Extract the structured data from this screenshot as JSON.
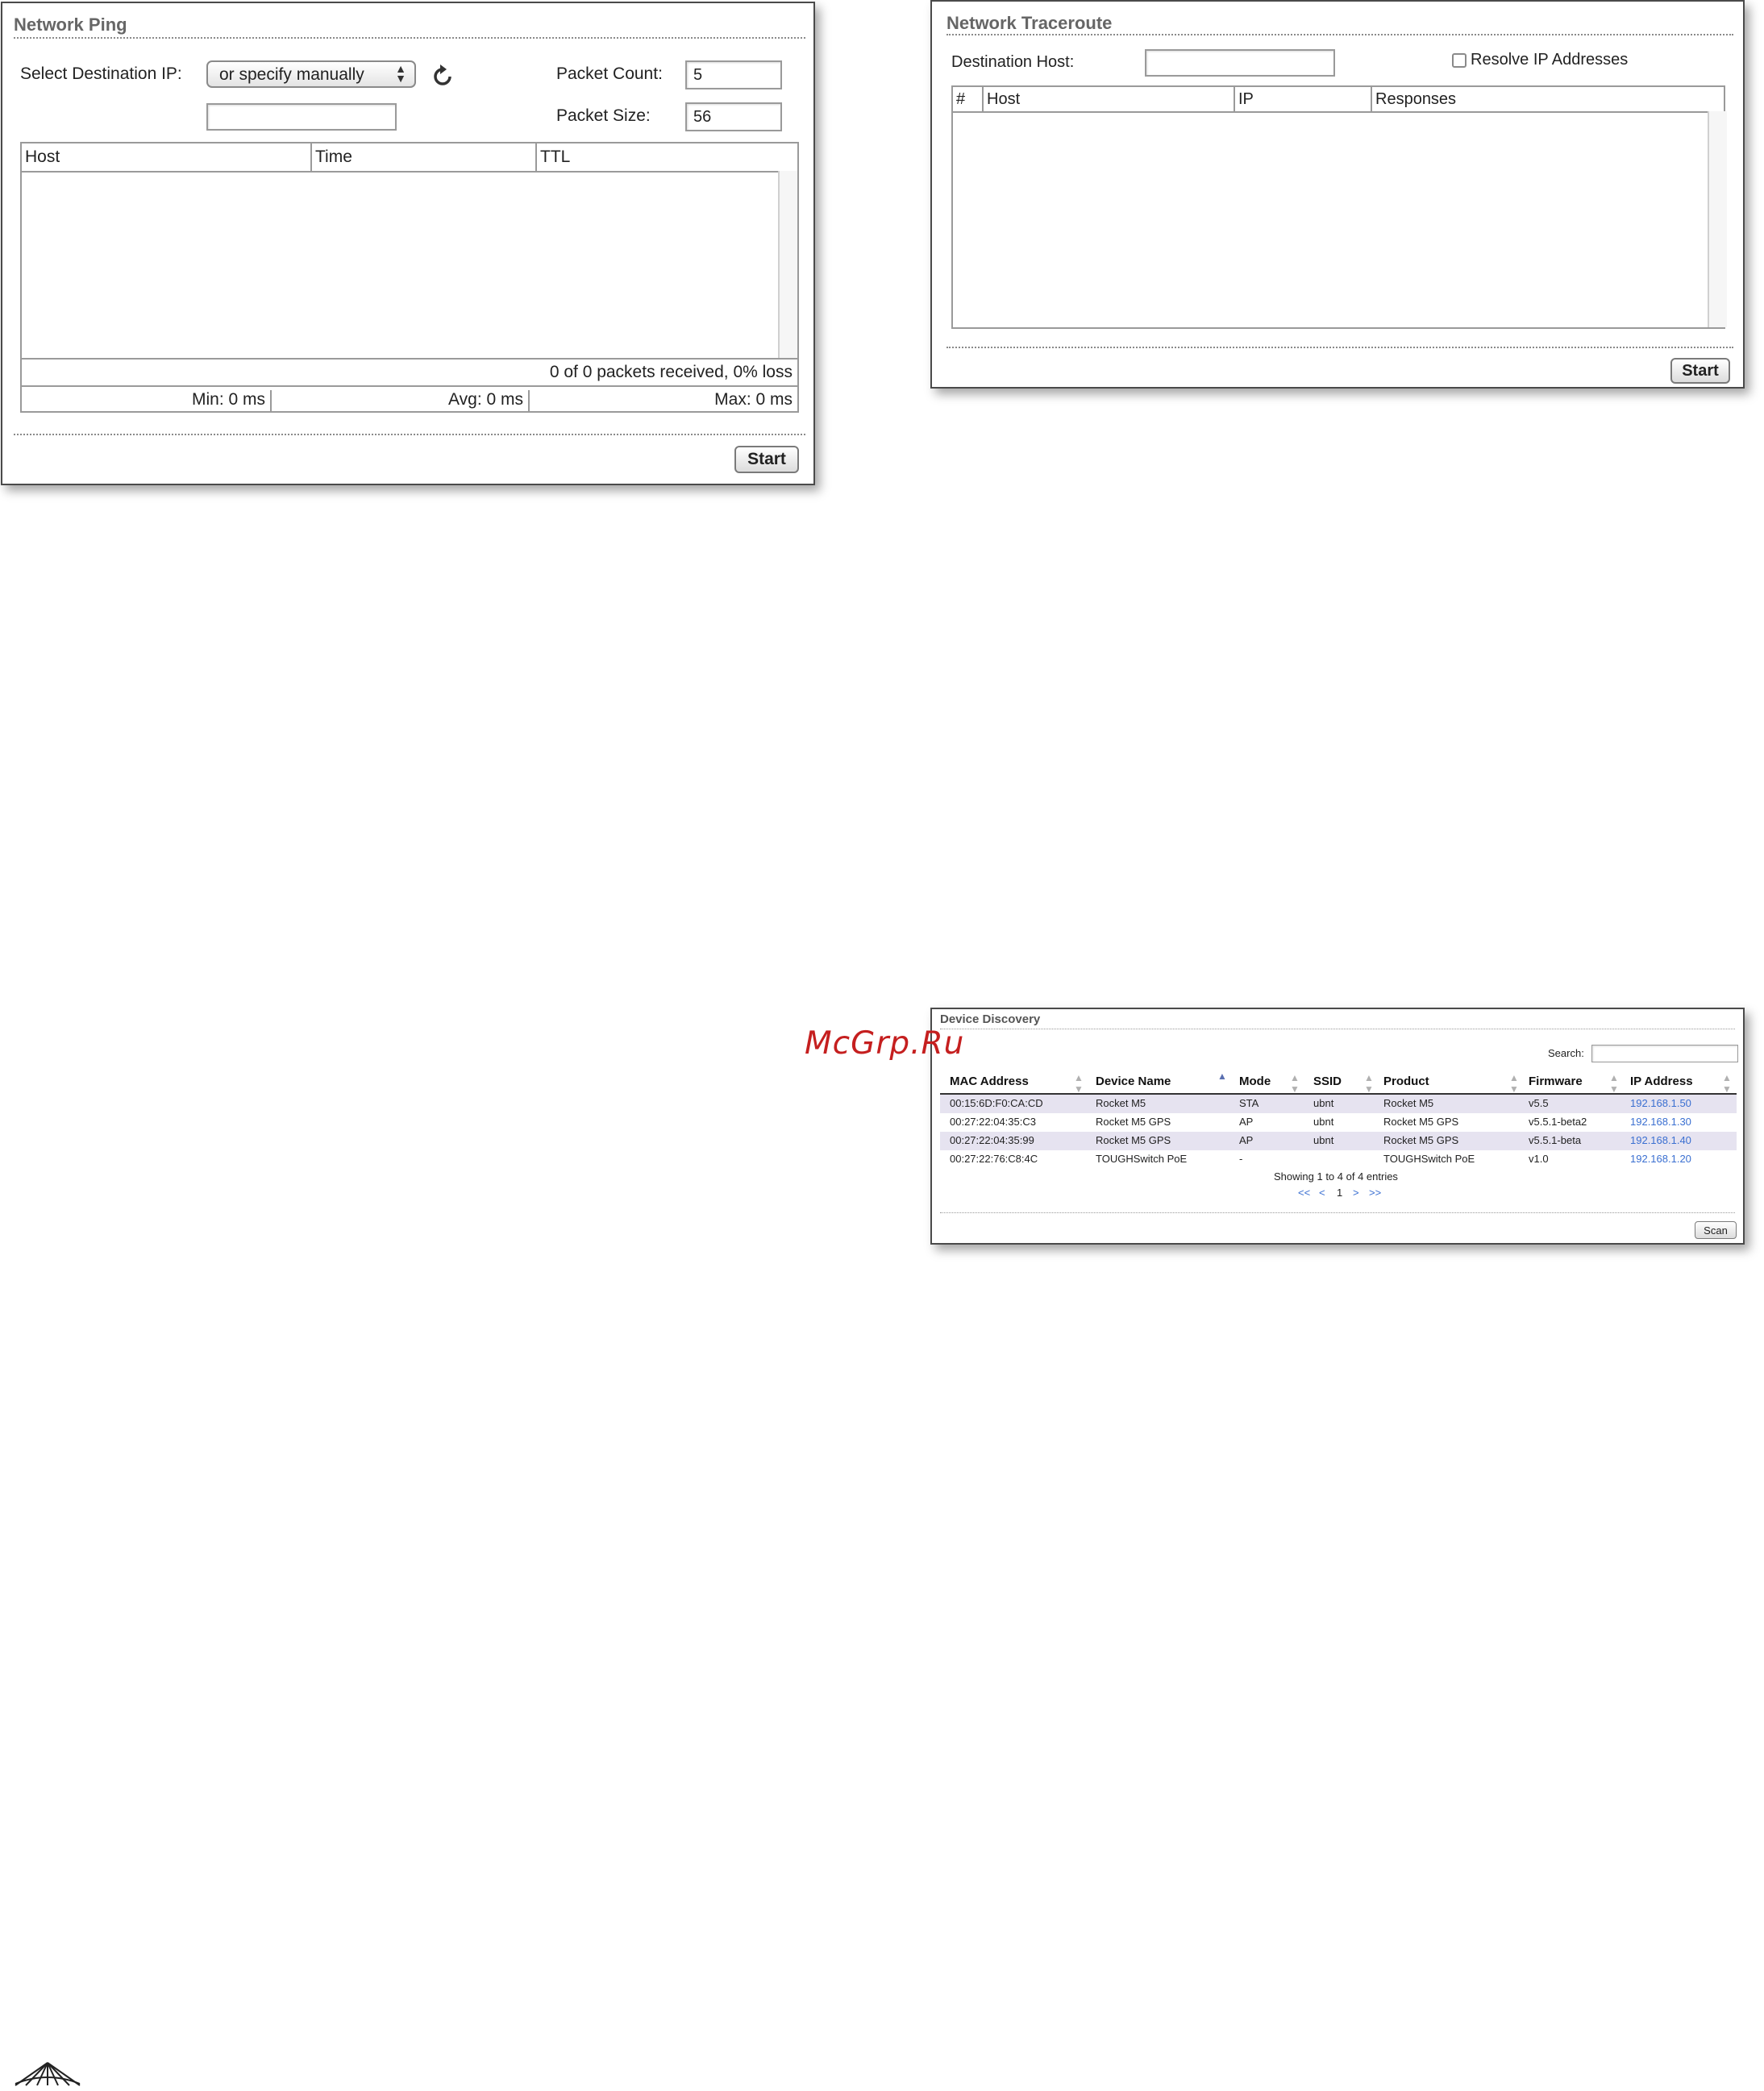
{
  "ping": {
    "title": "Network Ping",
    "dest_label": "Select Destination IP:",
    "dest_select": "or specify manually",
    "manual_ip_value": "",
    "count_label": "Packet Count:",
    "count_value": "5",
    "size_label": "Packet Size:",
    "size_value": "56",
    "columns": [
      "Host",
      "Time",
      "TTL"
    ],
    "summary": "0 of 0 packets received, 0% loss",
    "min": "Min: 0 ms",
    "avg": "Avg: 0 ms",
    "max": "Max: 0 ms",
    "start_label": "Start"
  },
  "traceroute": {
    "title": "Network Traceroute",
    "dest_label": "Destination Host:",
    "dest_value": "",
    "resolve_label": "Resolve IP Addresses",
    "resolve_checked": false,
    "columns": [
      "#",
      "Host",
      "IP",
      "Responses"
    ],
    "start_label": "Start"
  },
  "discovery": {
    "title": "Device Discovery",
    "search_label": "Search:",
    "search_value": "",
    "columns": [
      "MAC Address",
      "Device Name",
      "Mode",
      "SSID",
      "Product",
      "Firmware",
      "IP Address"
    ],
    "rows": [
      [
        "00:15:6D:F0:CA:CD",
        "Rocket M5",
        "STA",
        "ubnt",
        "Rocket M5",
        "v5.5",
        "192.168.1.50"
      ],
      [
        "00:27:22:04:35:C3",
        "Rocket M5 GPS",
        "AP",
        "ubnt",
        "Rocket M5 GPS",
        "v5.5.1-beta2",
        "192.168.1.30"
      ],
      [
        "00:27:22:04:35:99",
        "Rocket M5 GPS",
        "AP",
        "ubnt",
        "Rocket M5 GPS",
        "v5.5.1-beta",
        "192.168.1.40"
      ],
      [
        "00:27:22:76:C8:4C",
        "TOUGHSwitch PoE",
        "-",
        "",
        "TOUGHSwitch PoE",
        "v1.0",
        "192.168.1.20"
      ]
    ],
    "showing": "Showing 1 to 4 of 4 entries",
    "pager": {
      "first": "<<",
      "prev": "<",
      "page": "1",
      "next": ">",
      "last": ">>"
    },
    "scan_label": "Scan",
    "row_stripe_color": "#e6e3f0"
  },
  "watermark": "McGrp.Ru"
}
